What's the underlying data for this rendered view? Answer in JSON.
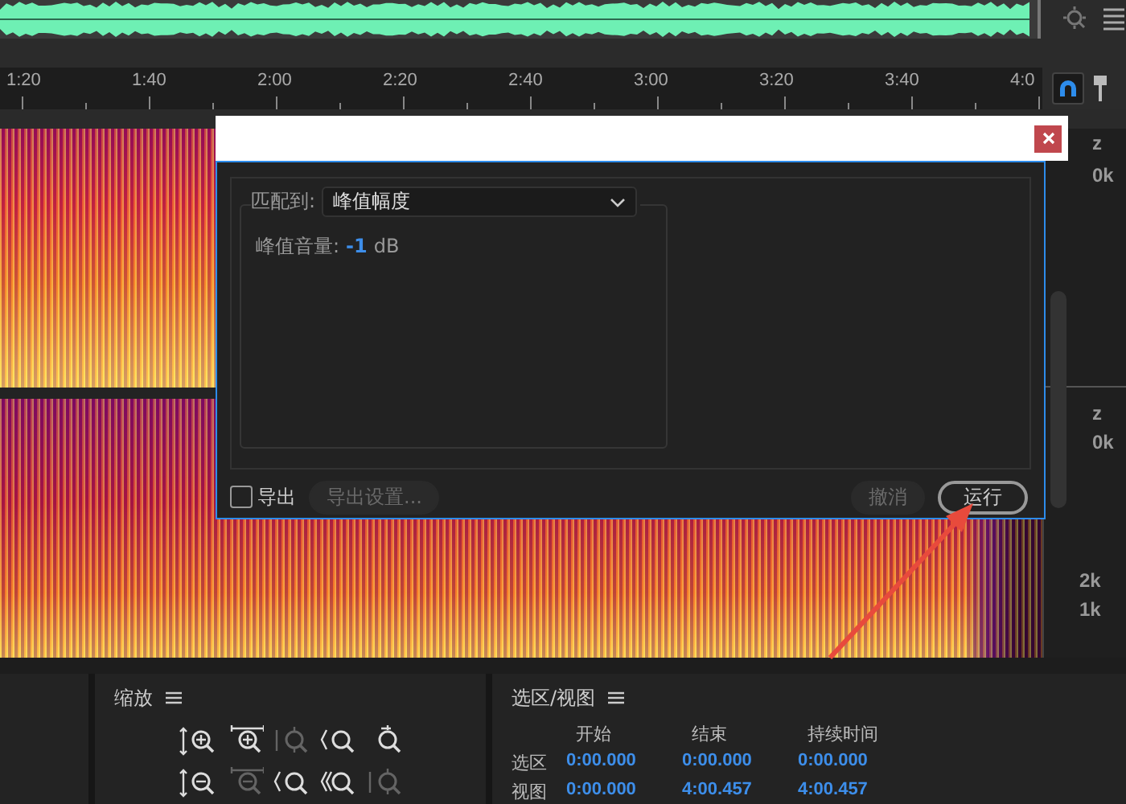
{
  "ruler": {
    "ticks": [
      "1:20",
      "1:40",
      "2:00",
      "2:20",
      "2:40",
      "3:00",
      "3:20",
      "3:40",
      "4:0"
    ]
  },
  "tracks": [
    {
      "axis_labels": [
        "z",
        "0k"
      ]
    },
    {
      "axis_labels": [
        "z",
        "0k",
        "2k",
        "1k"
      ]
    }
  ],
  "dialog": {
    "match_label": "匹配到:",
    "match_value": "峰值幅度",
    "peak_label": "峰值音量:",
    "peak_value": "-1",
    "peak_unit": "dB",
    "export": {
      "label": "导出",
      "checked": false
    },
    "export_settings": {
      "label": "导出设置...",
      "disabled": true
    },
    "buttons": [
      {
        "label": "撤消",
        "disabled": true
      },
      {
        "label": "运行",
        "disabled": false
      }
    ]
  },
  "zoom_panel": {
    "title": "缩放",
    "tools": [
      {
        "kind": "amp-in",
        "disabled": false
      },
      {
        "kind": "time-in",
        "disabled": false
      },
      {
        "kind": "selection",
        "disabled": true
      },
      {
        "kind": "out-left",
        "disabled": false
      },
      {
        "kind": "reset",
        "disabled": false
      },
      {
        "kind": "amp-out",
        "disabled": false
      },
      {
        "kind": "time-out",
        "disabled": true
      },
      {
        "kind": "in-left",
        "disabled": false
      },
      {
        "kind": "both",
        "disabled": false
      },
      {
        "kind": "track",
        "disabled": true
      }
    ]
  },
  "selection_panel": {
    "title": "选区/视图",
    "columns": [
      "开始",
      "结束",
      "持续时间"
    ],
    "rows": [
      {
        "label": "选区",
        "values": [
          "0:00.000",
          "0:00.000",
          "0:00.000"
        ]
      },
      {
        "label": "视图",
        "values": [
          "0:00.000",
          "4:00.457",
          "4:00.457"
        ]
      }
    ]
  }
}
